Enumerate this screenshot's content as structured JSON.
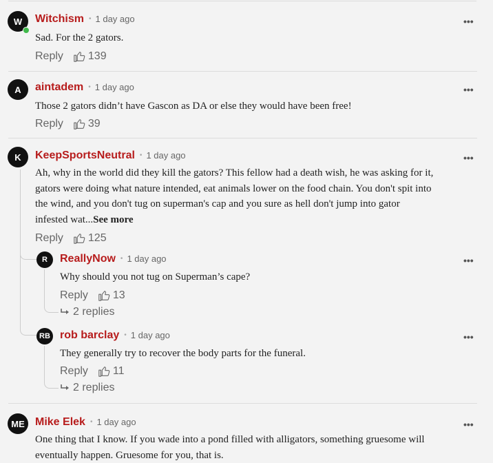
{
  "comments": [
    {
      "avatar": "W",
      "author": "Witchism",
      "time": "1 day ago",
      "text": "Sad.  For the 2 gators.",
      "reply_label": "Reply",
      "likes": "139",
      "online": true
    },
    {
      "avatar": "A",
      "author": "aintadem",
      "time": "1 day ago",
      "text": "Those 2 gators didn’t have Gascon as DA or else they would have been free!",
      "reply_label": "Reply",
      "likes": "39"
    },
    {
      "avatar": "K",
      "author": "KeepSportsNeutral",
      "time": "1 day ago",
      "text_lines": [
        "Ah, why in the world did they kill the gators?  This fellow had a death wish, he was asking for it,",
        "gators were doing what nature intended, eat animals lower on the food chain.  You don't spit into",
        "the wind, and you don't tug on superman's cap and you sure as hell don't jump into gator",
        "infested wat..."
      ],
      "see_more": "See more",
      "reply_label": "Reply",
      "likes": "125",
      "replies": [
        {
          "avatar": "R",
          "author": "ReallyNow",
          "time": "1 day ago",
          "text": "Why should you not tug on Superman’s cape?",
          "reply_label": "Reply",
          "likes": "13",
          "replies_count": "2 replies"
        },
        {
          "avatar": "RB",
          "author": "rob barclay",
          "time": "1 day ago",
          "text": "They generally try to recover the body parts for the funeral.",
          "reply_label": "Reply",
          "likes": "11",
          "replies_count": "2 replies"
        }
      ]
    },
    {
      "avatar": "ME",
      "author": "Mike Elek",
      "time": "1 day ago",
      "text_lines": [
        "One thing that I know. If you wade into a pond filled with alligators, something gruesome will",
        "eventually happen. Gruesome for you, that is."
      ]
    }
  ],
  "ui": {
    "more_glyph": "•••",
    "separator": "•"
  },
  "colors": {
    "author": "#b71c1c",
    "background": "#f3f3f3",
    "avatar": "#111111",
    "online": "#3fb94a"
  },
  "icons": {
    "like": "thumbs-up-icon",
    "reply_arrow": "reply-arrow-icon",
    "more": "more-options-icon"
  }
}
